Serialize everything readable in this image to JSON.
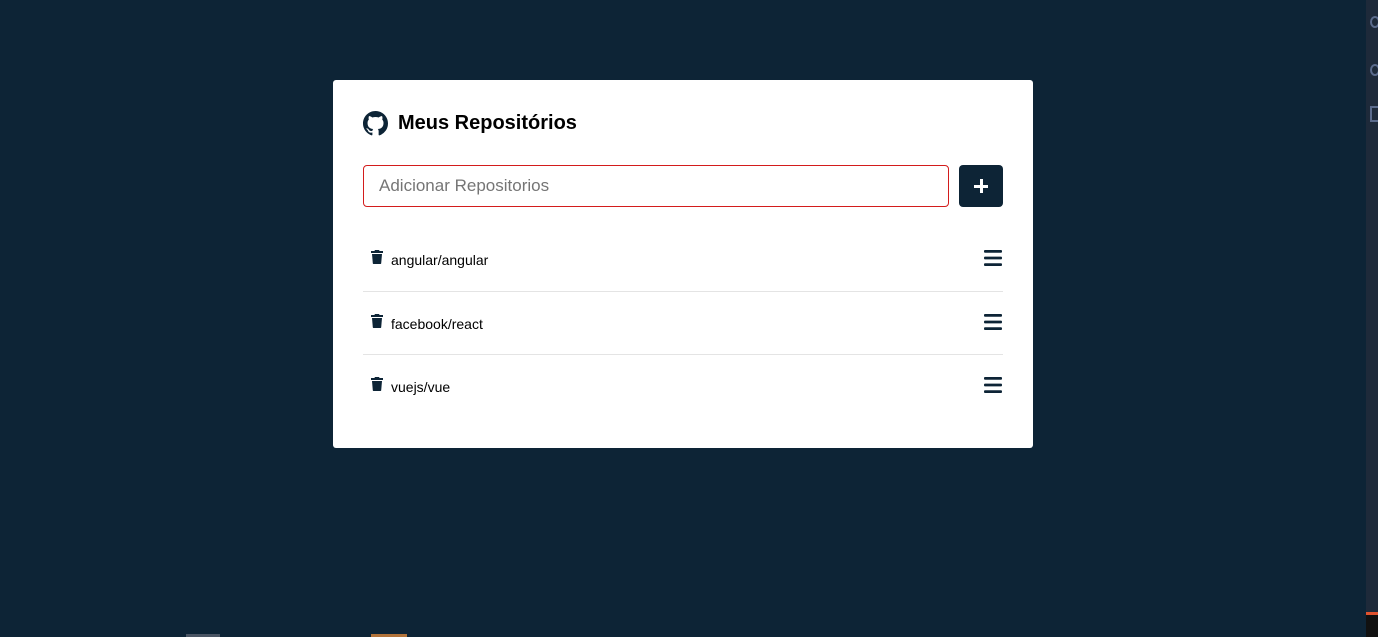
{
  "header": {
    "title": "Meus Repositórios"
  },
  "form": {
    "input_placeholder": "Adicionar Repositorios",
    "input_value": "",
    "add_button_icon": "plus-icon"
  },
  "repositories": [
    {
      "name": "angular/angular"
    },
    {
      "name": "facebook/react"
    },
    {
      "name": "vuejs/vue"
    }
  ],
  "colors": {
    "background": "#0d2436",
    "card": "#ffffff",
    "input_border_error": "#d31c1c",
    "button": "#0d2436"
  }
}
